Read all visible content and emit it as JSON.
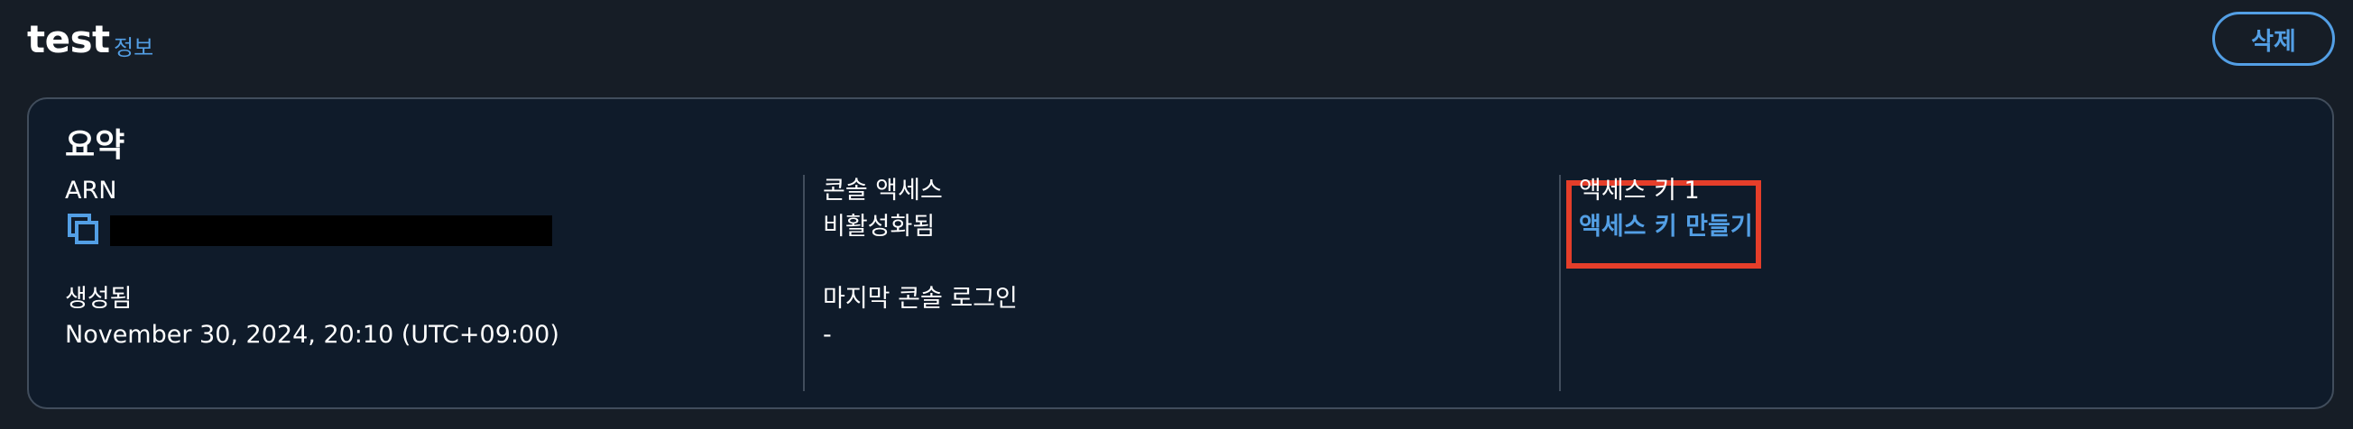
{
  "header": {
    "title": "test",
    "info_link": "정보",
    "delete_button": "삭제"
  },
  "summary": {
    "title": "요약",
    "arn": {
      "label": "ARN",
      "value_redacted": true
    },
    "created": {
      "label": "생성됨",
      "value": "November 30, 2024, 20:10 (UTC+09:00)"
    },
    "console_access": {
      "label": "콘솔 액세스",
      "value": "비활성화됨"
    },
    "last_console_login": {
      "label": "마지막 콘솔 로그인",
      "value": "-"
    },
    "access_key": {
      "label": "액세스 키 1",
      "action": "액세스 키 만들기"
    }
  },
  "colors": {
    "background": "#161d26",
    "card": "#0f1b2a",
    "border": "#414d5c",
    "link": "#539fe5",
    "highlight": "#e53e2a"
  },
  "icons": {
    "copy": "copy-icon"
  }
}
